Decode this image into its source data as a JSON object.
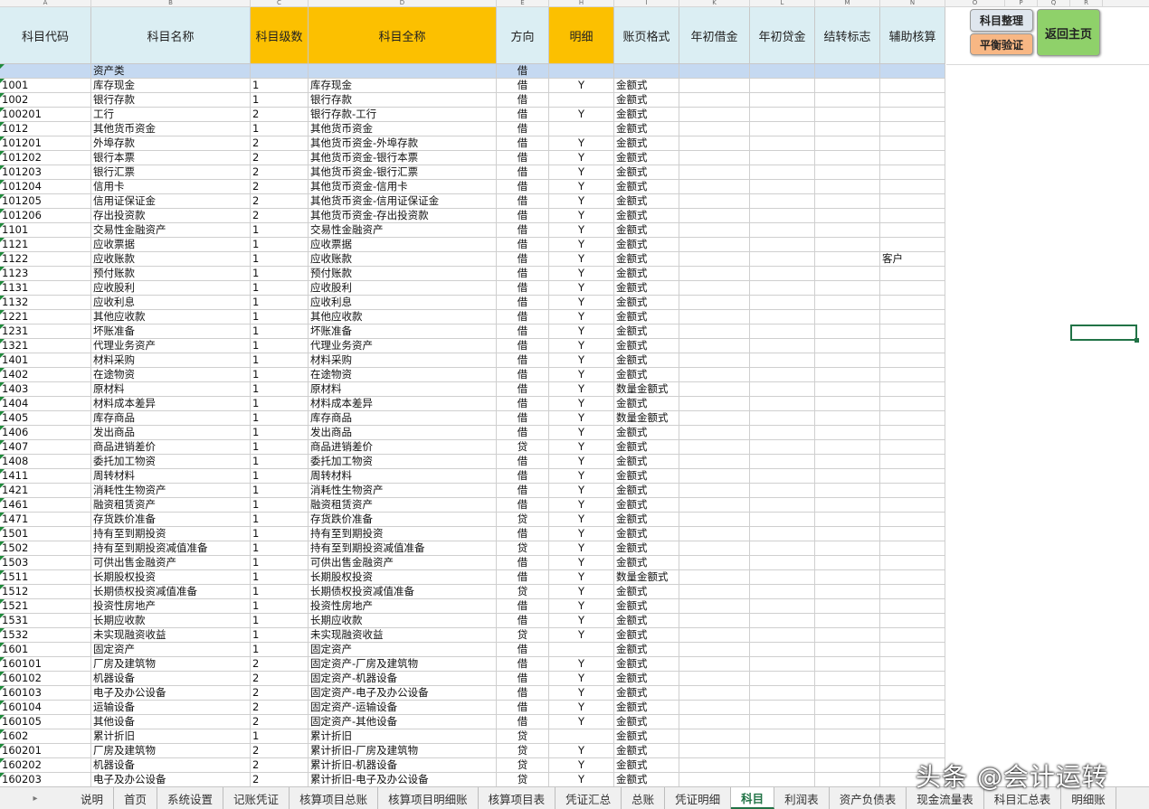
{
  "column_letters": [
    "A",
    "B",
    "C",
    "D",
    "E",
    "H",
    "I",
    "K",
    "L",
    "M",
    "N",
    "O",
    "P",
    "Q",
    "R"
  ],
  "headers": [
    {
      "label": "科目代码",
      "yellow": false
    },
    {
      "label": "科目名称",
      "yellow": false
    },
    {
      "label": "科目级数",
      "yellow": true
    },
    {
      "label": "科目全称",
      "yellow": true
    },
    {
      "label": "方向",
      "yellow": false
    },
    {
      "label": "明细",
      "yellow": true
    },
    {
      "label": "账页格式",
      "yellow": false
    },
    {
      "label": "年初借金",
      "yellow": false
    },
    {
      "label": "年初贷金",
      "yellow": false
    },
    {
      "label": "结转标志",
      "yellow": false
    },
    {
      "label": "辅助核算",
      "yellow": false
    }
  ],
  "rows": [
    [
      "",
      "资产类",
      "",
      "",
      "借",
      "",
      "",
      "",
      "",
      "",
      ""
    ],
    [
      "1001",
      "库存现金",
      "1",
      "库存现金",
      "借",
      "Y",
      "金额式",
      "",
      "",
      "",
      ""
    ],
    [
      "1002",
      "银行存款",
      "1",
      "银行存款",
      "借",
      "",
      "金额式",
      "",
      "",
      "",
      ""
    ],
    [
      "100201",
      "工行",
      "2",
      "银行存款-工行",
      "借",
      "Y",
      "金额式",
      "",
      "",
      "",
      ""
    ],
    [
      "1012",
      "其他货币资金",
      "1",
      "其他货币资金",
      "借",
      "",
      "金额式",
      "",
      "",
      "",
      ""
    ],
    [
      "101201",
      "外埠存款",
      "2",
      "其他货币资金-外埠存款",
      "借",
      "Y",
      "金额式",
      "",
      "",
      "",
      ""
    ],
    [
      "101202",
      "银行本票",
      "2",
      "其他货币资金-银行本票",
      "借",
      "Y",
      "金额式",
      "",
      "",
      "",
      ""
    ],
    [
      "101203",
      "银行汇票",
      "2",
      "其他货币资金-银行汇票",
      "借",
      "Y",
      "金额式",
      "",
      "",
      "",
      ""
    ],
    [
      "101204",
      "信用卡",
      "2",
      "其他货币资金-信用卡",
      "借",
      "Y",
      "金额式",
      "",
      "",
      "",
      ""
    ],
    [
      "101205",
      "信用证保证金",
      "2",
      "其他货币资金-信用证保证金",
      "借",
      "Y",
      "金额式",
      "",
      "",
      "",
      ""
    ],
    [
      "101206",
      "存出投资款",
      "2",
      "其他货币资金-存出投资款",
      "借",
      "Y",
      "金额式",
      "",
      "",
      "",
      ""
    ],
    [
      "1101",
      "交易性金融资产",
      "1",
      "交易性金融资产",
      "借",
      "Y",
      "金额式",
      "",
      "",
      "",
      ""
    ],
    [
      "1121",
      "应收票据",
      "1",
      "应收票据",
      "借",
      "Y",
      "金额式",
      "",
      "",
      "",
      ""
    ],
    [
      "1122",
      "应收账款",
      "1",
      "应收账款",
      "借",
      "Y",
      "金额式",
      "",
      "",
      "",
      "客户"
    ],
    [
      "1123",
      "预付账款",
      "1",
      "预付账款",
      "借",
      "Y",
      "金额式",
      "",
      "",
      "",
      ""
    ],
    [
      "1131",
      "应收股利",
      "1",
      "应收股利",
      "借",
      "Y",
      "金额式",
      "",
      "",
      "",
      ""
    ],
    [
      "1132",
      "应收利息",
      "1",
      "应收利息",
      "借",
      "Y",
      "金额式",
      "",
      "",
      "",
      ""
    ],
    [
      "1221",
      "其他应收款",
      "1",
      "其他应收款",
      "借",
      "Y",
      "金额式",
      "",
      "",
      "",
      ""
    ],
    [
      "1231",
      "坏账准备",
      "1",
      "坏账准备",
      "借",
      "Y",
      "金额式",
      "",
      "",
      "",
      ""
    ],
    [
      "1321",
      "代理业务资产",
      "1",
      "代理业务资产",
      "借",
      "Y",
      "金额式",
      "",
      "",
      "",
      ""
    ],
    [
      "1401",
      "材料采购",
      "1",
      "材料采购",
      "借",
      "Y",
      "金额式",
      "",
      "",
      "",
      ""
    ],
    [
      "1402",
      "在途物资",
      "1",
      "在途物资",
      "借",
      "Y",
      "金额式",
      "",
      "",
      "",
      ""
    ],
    [
      "1403",
      "原材料",
      "1",
      "原材料",
      "借",
      "Y",
      "数量金额式",
      "",
      "",
      "",
      ""
    ],
    [
      "1404",
      "材料成本差异",
      "1",
      "材料成本差异",
      "借",
      "Y",
      "金额式",
      "",
      "",
      "",
      ""
    ],
    [
      "1405",
      "库存商品",
      "1",
      "库存商品",
      "借",
      "Y",
      "数量金额式",
      "",
      "",
      "",
      ""
    ],
    [
      "1406",
      "发出商品",
      "1",
      "发出商品",
      "借",
      "Y",
      "金额式",
      "",
      "",
      "",
      ""
    ],
    [
      "1407",
      "商品进销差价",
      "1",
      "商品进销差价",
      "贷",
      "Y",
      "金额式",
      "",
      "",
      "",
      ""
    ],
    [
      "1408",
      "委托加工物资",
      "1",
      "委托加工物资",
      "借",
      "Y",
      "金额式",
      "",
      "",
      "",
      ""
    ],
    [
      "1411",
      "周转材料",
      "1",
      "周转材料",
      "借",
      "Y",
      "金额式",
      "",
      "",
      "",
      ""
    ],
    [
      "1421",
      "消耗性生物资产",
      "1",
      "消耗性生物资产",
      "借",
      "Y",
      "金额式",
      "",
      "",
      "",
      ""
    ],
    [
      "1461",
      "融资租赁资产",
      "1",
      "融资租赁资产",
      "借",
      "Y",
      "金额式",
      "",
      "",
      "",
      ""
    ],
    [
      "1471",
      "存货跌价准备",
      "1",
      "存货跌价准备",
      "贷",
      "Y",
      "金额式",
      "",
      "",
      "",
      ""
    ],
    [
      "1501",
      "持有至到期投资",
      "1",
      "持有至到期投资",
      "借",
      "Y",
      "金额式",
      "",
      "",
      "",
      ""
    ],
    [
      "1502",
      "持有至到期投资减值准备",
      "1",
      "持有至到期投资减值准备",
      "贷",
      "Y",
      "金额式",
      "",
      "",
      "",
      ""
    ],
    [
      "1503",
      "可供出售金融资产",
      "1",
      "可供出售金融资产",
      "借",
      "Y",
      "金额式",
      "",
      "",
      "",
      ""
    ],
    [
      "1511",
      "长期股权投资",
      "1",
      "长期股权投资",
      "借",
      "Y",
      "数量金额式",
      "",
      "",
      "",
      ""
    ],
    [
      "1512",
      "长期债权投资减值准备",
      "1",
      "长期债权投资减值准备",
      "贷",
      "Y",
      "金额式",
      "",
      "",
      "",
      ""
    ],
    [
      "1521",
      "投资性房地产",
      "1",
      "投资性房地产",
      "借",
      "Y",
      "金额式",
      "",
      "",
      "",
      ""
    ],
    [
      "1531",
      "长期应收款",
      "1",
      "长期应收款",
      "借",
      "Y",
      "金额式",
      "",
      "",
      "",
      ""
    ],
    [
      "1532",
      "未实现融资收益",
      "1",
      "未实现融资收益",
      "贷",
      "Y",
      "金额式",
      "",
      "",
      "",
      ""
    ],
    [
      "1601",
      "固定资产",
      "1",
      "固定资产",
      "借",
      "",
      "金额式",
      "",
      "",
      "",
      ""
    ],
    [
      "160101",
      "厂房及建筑物",
      "2",
      "固定资产-厂房及建筑物",
      "借",
      "Y",
      "金额式",
      "",
      "",
      "",
      ""
    ],
    [
      "160102",
      "机器设备",
      "2",
      "固定资产-机器设备",
      "借",
      "Y",
      "金额式",
      "",
      "",
      "",
      ""
    ],
    [
      "160103",
      "  电子及办公设备",
      "2",
      "固定资产-电子及办公设备",
      "借",
      "Y",
      "金额式",
      "",
      "",
      "",
      ""
    ],
    [
      "160104",
      "运输设备",
      "2",
      "固定资产-运输设备",
      "借",
      "Y",
      "金额式",
      "",
      "",
      "",
      ""
    ],
    [
      "160105",
      "其他设备",
      "2",
      "固定资产-其他设备",
      "借",
      "Y",
      "金额式",
      "",
      "",
      "",
      ""
    ],
    [
      "1602",
      "累计折旧",
      "1",
      "累计折旧",
      "贷",
      "",
      "金额式",
      "",
      "",
      "",
      ""
    ],
    [
      "160201",
      "厂房及建筑物",
      "2",
      "累计折旧-厂房及建筑物",
      "贷",
      "Y",
      "金额式",
      "",
      "",
      "",
      ""
    ],
    [
      "160202",
      "机器设备",
      "2",
      "累计折旧-机器设备",
      "贷",
      "Y",
      "金额式",
      "",
      "",
      "",
      ""
    ],
    [
      "160203",
      "  电子及办公设备",
      "2",
      "累计折旧-电子及办公设备",
      "贷",
      "Y",
      "金额式",
      "",
      "",
      "",
      ""
    ]
  ],
  "buttons": {
    "subject_organize": "科目整理",
    "balance_verify": "平衡验证",
    "return_home": "返回主页"
  },
  "tab_nav": "▸",
  "tabs": [
    "说明",
    "首页",
    "系统设置",
    "记账凭证",
    "核算项目总账",
    "核算项目明细账",
    "核算项目表",
    "凭证汇总",
    "总账",
    "凭证明细",
    "科目",
    "利润表",
    "资产负债表",
    "现金流量表",
    "科目汇总表",
    "明细账"
  ],
  "active_tab_index": 10,
  "watermark": "头条 @会计运转",
  "colors": {
    "header_blue": "#dbeef3",
    "header_yellow": "#fcc000",
    "category_row": "#c5d9f1",
    "btn_green": "#8fd16a",
    "btn_orange": "#f8b784",
    "btn_grey": "#dfe6ee",
    "selection": "#217346"
  }
}
